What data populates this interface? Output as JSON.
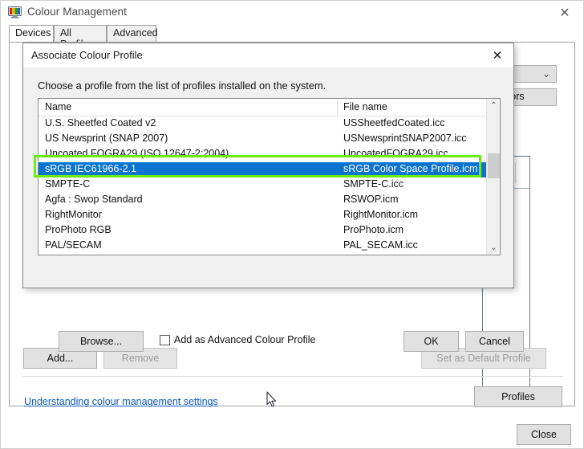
{
  "main_window": {
    "title": "Colour Management",
    "icon": "monitor-colour-icon",
    "close_glyph": "✕",
    "tabs": [
      {
        "label": "Devices",
        "active": true
      },
      {
        "label": "All Profiles",
        "active": false
      },
      {
        "label": "Advanced",
        "active": false
      }
    ],
    "device_combo": {
      "value": "",
      "chevron": "⌄"
    },
    "identify_button": "itors",
    "buttons": {
      "add": "Add...",
      "remove": "Remove",
      "set_default": "Set as Default Profile",
      "profiles": "Profiles",
      "close": "Close"
    },
    "link": "Understanding colour management settings"
  },
  "dialog": {
    "title": "Associate Colour Profile",
    "close_glyph": "✕",
    "prompt": "Choose a profile from the list of profiles installed on the system.",
    "list": {
      "columns": [
        "Name",
        "File name"
      ],
      "rows": [
        {
          "name": "U.S. Sheetfed Coated v2",
          "file": "USSheetfedCoated.icc",
          "selected": false
        },
        {
          "name": "US Newsprint (SNAP 2007)",
          "file": "USNewsprintSNAP2007.icc",
          "selected": false
        },
        {
          "name": "Uncoated FOGRA29 (ISO 12647-2:2004)",
          "file": "UncoatedFOGRA29.icc",
          "selected": false
        },
        {
          "name": "sRGB IEC61966-2.1",
          "file": "sRGB Color Space Profile.icm",
          "selected": true
        },
        {
          "name": "SMPTE-C",
          "file": "SMPTE-C.icc",
          "selected": false
        },
        {
          "name": "Agfa : Swop Standard",
          "file": "RSWOP.icm",
          "selected": false
        },
        {
          "name": "RightMonitor",
          "file": "RightMonitor.icm",
          "selected": false
        },
        {
          "name": "ProPhoto RGB",
          "file": "ProPhoto.icm",
          "selected": false
        },
        {
          "name": "PAL/SECAM",
          "file": "PAL_SECAM.icc",
          "selected": false
        }
      ],
      "scroll_up_glyph": "⌃",
      "scroll_down_glyph": "⌄"
    },
    "browse_button": "Browse...",
    "advanced_checkbox": {
      "label": "Add as Advanced Colour Profile",
      "checked": false
    },
    "ok_button": "OK",
    "cancel_button": "Cancel"
  },
  "annotation": {
    "target": "sRGB IEC61966-2.1",
    "colour": "#6aee10"
  },
  "colours": {
    "selection_blue": "#0a74d0",
    "link_blue": "#0a58c4",
    "dialog_face": "#f0f0f0",
    "button_face": "#e1e1e1"
  }
}
